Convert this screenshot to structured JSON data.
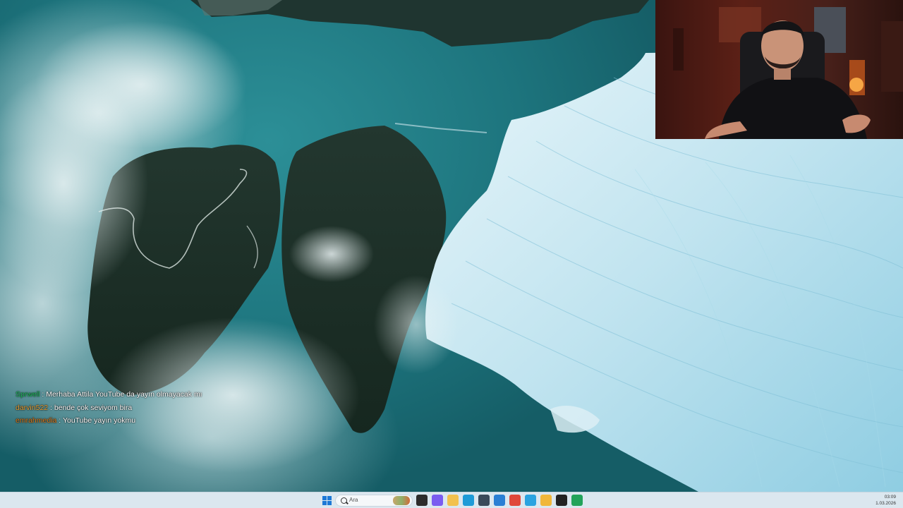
{
  "chat": {
    "messages": [
      {
        "user": "Sprwell",
        "user_color": "#1fbf5f",
        "text": ": Merhaba Attila YouTube da yayın olmayacak mı"
      },
      {
        "user": "darvin522",
        "user_color": "#e8a33a",
        "text": ": bende çok seviyom bira"
      },
      {
        "user": "emrahmedia",
        "user_color": "#e07b1a",
        "text": ": YouTube yayın yokmu"
      }
    ]
  },
  "taskbar": {
    "search_label": "Ara",
    "clock_time": "03:09",
    "clock_date": "1.03.2026",
    "apps": [
      {
        "name": "task-view-icon",
        "color": "#2c2c2c"
      },
      {
        "name": "copilot-icon",
        "color": "#7a5cf0"
      },
      {
        "name": "file-explorer-icon",
        "color": "#f2c14e"
      },
      {
        "name": "edge-icon",
        "color": "#1e9bd7"
      },
      {
        "name": "calculator-icon",
        "color": "#3a4a5a"
      },
      {
        "name": "app-cloud-icon",
        "color": "#2a7fd4"
      },
      {
        "name": "chrome-icon",
        "color": "#e0483a"
      },
      {
        "name": "telegram-icon",
        "color": "#2aa3e0"
      },
      {
        "name": "app-yellow-icon",
        "color": "#f0b73a"
      },
      {
        "name": "obs-icon",
        "color": "#222222"
      },
      {
        "name": "app-green-icon",
        "color": "#22a35a"
      }
    ]
  },
  "colors": {
    "taskbar_bg": "#dbe7ef",
    "ocean": "#1d747d",
    "glacier": "#cfe9f3"
  }
}
